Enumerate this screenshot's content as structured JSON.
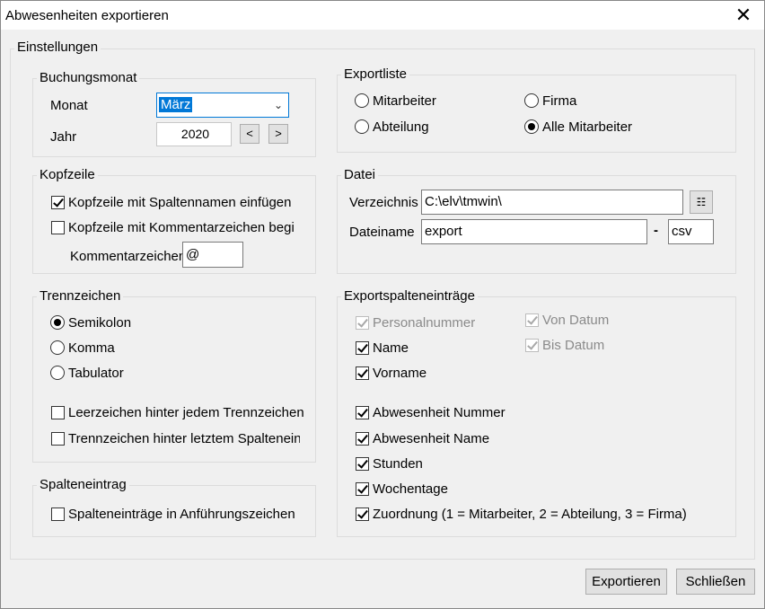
{
  "window": {
    "title": "Abwesenheiten exportieren",
    "close_glyph": "✕"
  },
  "settings": {
    "label": "Einstellungen"
  },
  "buchungsmonat": {
    "label": "Buchungsmonat",
    "monat_label": "Monat",
    "monat_value": "März",
    "jahr_label": "Jahr",
    "jahr_value": "2020",
    "prev": "<",
    "next": ">"
  },
  "kopfzeile": {
    "label": "Kopfzeile",
    "spaltennamen": "Kopfzeile mit Spaltennamen einfügen",
    "kommentar": "Kopfzeile mit Kommentarzeichen begi",
    "kommentarzeichen_label": "Kommentarzeichen",
    "kommentarzeichen_value": "@"
  },
  "trennzeichen": {
    "label": "Trennzeichen",
    "semikolon": "Semikolon",
    "komma": "Komma",
    "tabulator": "Tabulator",
    "leerzeichen": "Leerzeichen hinter jedem Trennzeichen",
    "letztem": "Trennzeichen hinter letztem Spaltenein"
  },
  "spalteneintrag": {
    "label": "Spalteneintrag",
    "anfuehrung": "Spalteneinträge in Anführungszeichen"
  },
  "exportliste": {
    "label": "Exportliste",
    "mitarbeiter": "Mitarbeiter",
    "firma": "Firma",
    "abteilung": "Abteilung",
    "alle": "Alle Mitarbeiter"
  },
  "datei": {
    "label": "Datei",
    "verzeichnis_label": "Verzeichnis",
    "verzeichnis_value": "C:\\elv\\tmwin\\",
    "dateiname_label": "Dateiname",
    "dateiname_value": "export",
    "dot": "-",
    "ext_value": "csv"
  },
  "exportspalten": {
    "label": "Exportspalteneinträge",
    "personalnummer": "Personalnummer",
    "von_datum": "Von Datum",
    "bis_datum": "Bis Datum",
    "name": "Name",
    "vorname": "Vorname",
    "abw_nummer": "Abwesenheit Nummer",
    "abw_name": "Abwesenheit Name",
    "stunden": "Stunden",
    "wochentage": "Wochentage",
    "zuordnung": "Zuordnung (1 = Mitarbeiter, 2 = Abteilung, 3 = Firma)"
  },
  "buttons": {
    "exportieren": "Exportieren",
    "schliessen": "Schließen"
  }
}
